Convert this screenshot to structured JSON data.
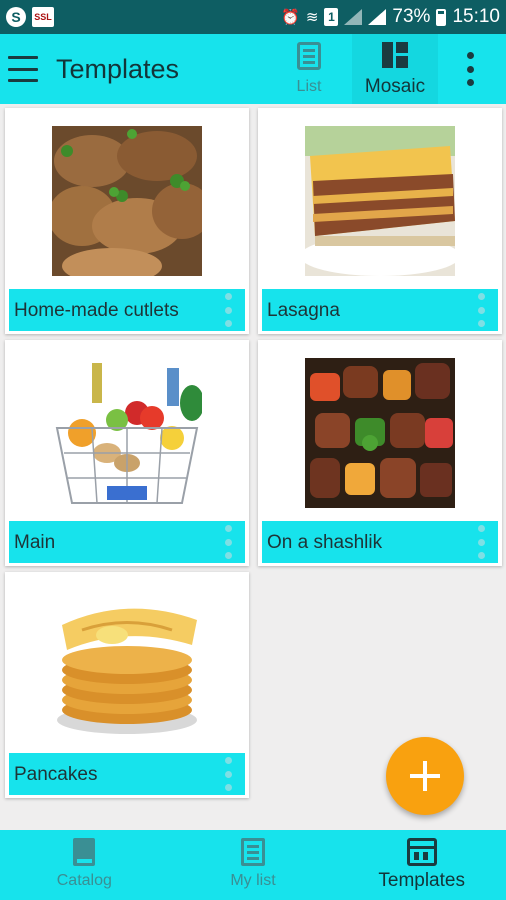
{
  "status_bar": {
    "battery": "73%",
    "time": "15:10",
    "sim": "1",
    "ssl_badge": "SSL"
  },
  "app_bar": {
    "title": "Templates",
    "view_options": [
      {
        "label": "List",
        "icon": "list-icon",
        "selected": false
      },
      {
        "label": "Mosaic",
        "icon": "mosaic-icon",
        "selected": true
      }
    ]
  },
  "templates": [
    {
      "label": "Home-made cutlets",
      "image": "cutlets"
    },
    {
      "label": "Lasagna",
      "image": "lasagna"
    },
    {
      "label": "Main",
      "image": "grocery-basket"
    },
    {
      "label": "On a shashlik",
      "image": "shashlik"
    },
    {
      "label": "Pancakes",
      "image": "pancakes"
    }
  ],
  "bottom_nav": [
    {
      "label": "Catalog",
      "icon": "book-icon",
      "selected": false
    },
    {
      "label": "My list",
      "icon": "list-doc-icon",
      "selected": false
    },
    {
      "label": "Templates",
      "icon": "templates-icon",
      "selected": true
    }
  ],
  "colors": {
    "accent": "#17e3ec",
    "status_bar": "#0e5e63",
    "fab": "#f9a10f"
  }
}
